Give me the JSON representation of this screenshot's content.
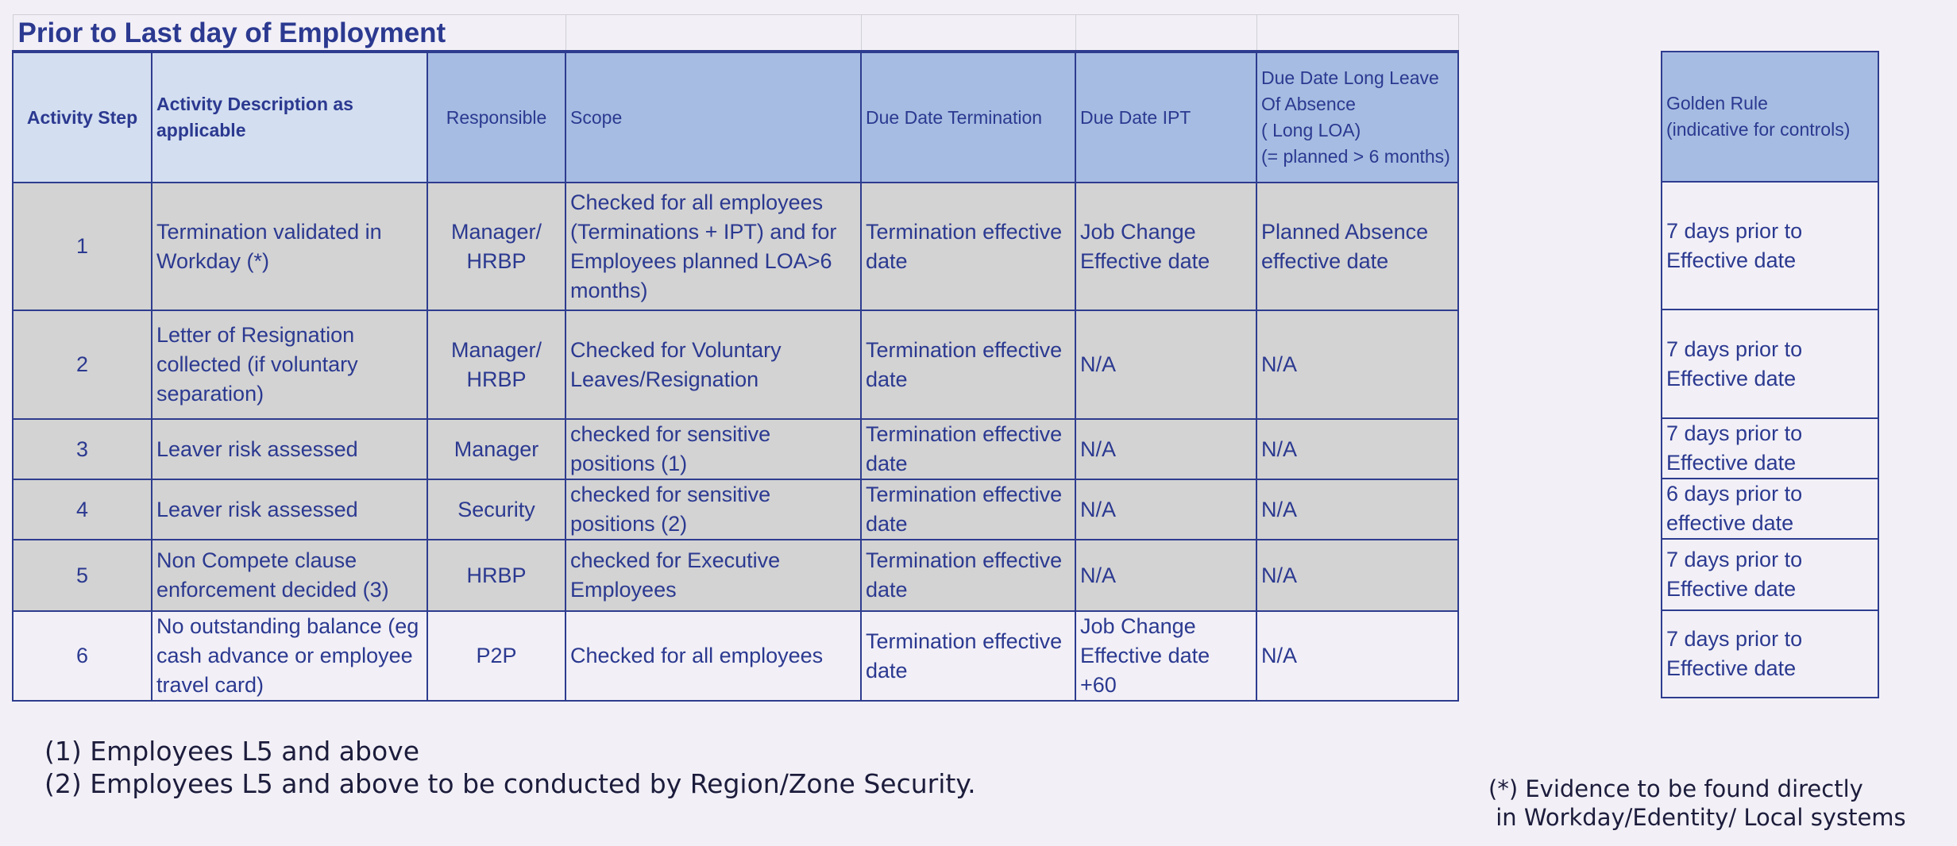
{
  "title": "Prior to Last day of Employment",
  "headers": {
    "step": "Activity Step",
    "description": "Activity Description as applicable",
    "responsible": "Responsible",
    "scope": "Scope",
    "due_termination": "Due Date Termination",
    "due_ipt": "Due Date IPT",
    "due_loa": [
      "Due Date Long Leave",
      "Of Absence",
      "( Long LOA)",
      "(= planned > 6 months)"
    ],
    "golden_rule": [
      "Golden Rule",
      "(indicative for controls)"
    ]
  },
  "rows": [
    {
      "step": "1",
      "description": "Termination validated in Workday (*)",
      "responsible": "Manager/ HRBP",
      "scope": "Checked for all employees (Terminations + IPT) and for Employees planned LOA>6 months)",
      "due_termination": "Termination effective date",
      "due_ipt": "Job Change Effective date",
      "due_loa": "Planned Absence effective date",
      "golden_rule": "7 days prior to Effective date"
    },
    {
      "step": "2",
      "description": "Letter of Resignation collected (if voluntary separation)",
      "responsible": "Manager/ HRBP",
      "scope": " Checked for Voluntary Leaves/Resignation",
      "due_termination": "Termination effective date",
      "due_ipt": "N/A",
      "due_loa": "N/A",
      "golden_rule": "7 days prior to Effective date"
    },
    {
      "step": "3",
      "description": "Leaver risk assessed",
      "responsible": "Manager",
      "scope": "checked for sensitive positions (1)",
      "due_termination": "Termination effective date",
      "due_ipt": "N/A",
      "due_loa": "N/A",
      "golden_rule": "7 days prior to Effective date"
    },
    {
      "step": "4",
      "description": "Leaver risk assessed",
      "responsible": "Security",
      "scope": "checked for sensitive positions (2)",
      "due_termination": "Termination effective date",
      "due_ipt": "N/A",
      "due_loa": "N/A",
      "golden_rule": "6 days prior to effective date"
    },
    {
      "step": "5",
      "description": "Non Compete clause enforcement decided (3)",
      "responsible": "HRBP",
      "scope": " checked for Executive Employees",
      "due_termination": "Termination effective date",
      "due_ipt": "N/A",
      "due_loa": "N/A",
      "golden_rule": "7 days prior to Effective date"
    },
    {
      "step": "6",
      "description": "No outstanding balance (eg cash advance or employee travel card)",
      "responsible": "P2P",
      "scope": "Checked for all employees",
      "due_termination": "Termination effective date",
      "due_ipt": "Job Change Effective date +60",
      "due_loa": "N/A",
      "golden_rule": "7 days prior to Effective date"
    }
  ],
  "footnotes": [
    "(1) Employees L5 and above",
    "(2) Employees L5 and above  to be conducted by Region/Zone Security."
  ],
  "evidence_note": "(*) Evidence to be found directly\n in Workday/Edentity/ Local systems",
  "colors": {
    "text": "#2b3990",
    "border": "#2e3c8f",
    "header_light": "#d3def0",
    "header_dark": "#a7bce2",
    "row_grey": "#d3d3d3",
    "background": "#f2f0f6"
  }
}
